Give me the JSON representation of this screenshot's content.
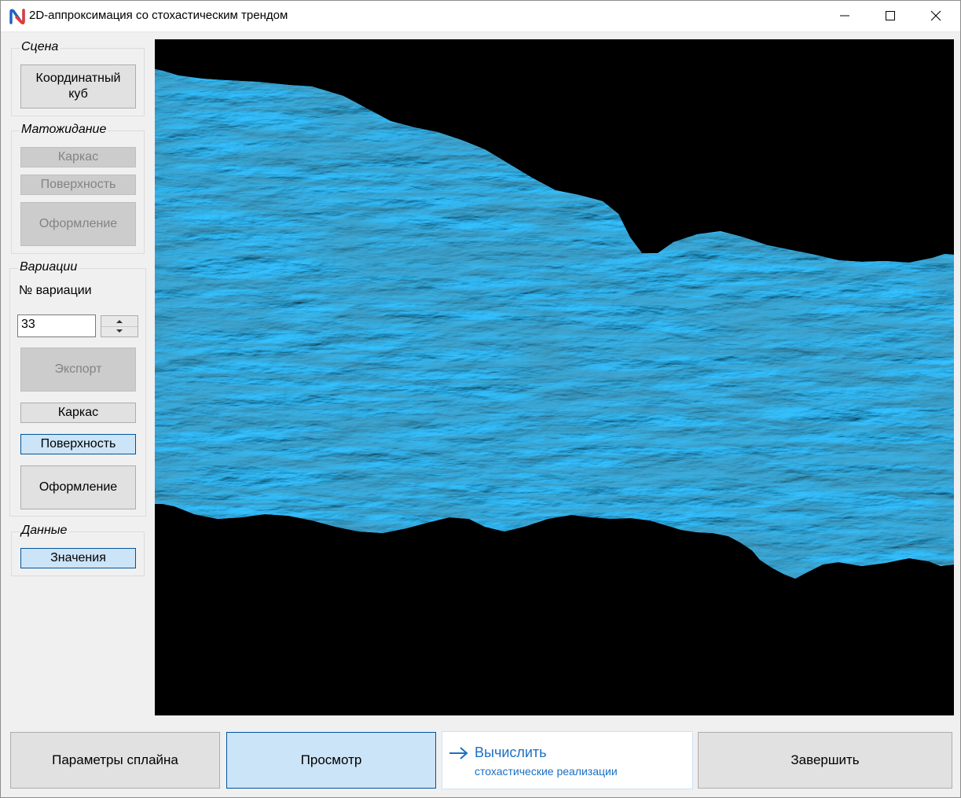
{
  "window": {
    "title": "2D-аппроксимация со стохастическим трендом",
    "controls": [
      "minimize-icon",
      "maximize-icon",
      "close-icon"
    ]
  },
  "scene": {
    "group_label": "Сцена",
    "coordinate_cube_label": "Координатный куб"
  },
  "expectation": {
    "group_label": "Матожидание",
    "wireframe_label": "Каркас",
    "surface_label": "Поверхность",
    "styling_label": "Оформление",
    "enabled": false
  },
  "variations": {
    "group_label": "Вариации",
    "number_label": "№ вариации",
    "number_value": "33",
    "export_label": "Экспорт",
    "wireframe_label": "Каркас",
    "surface_label": "Поверхность",
    "styling_label": "Оформление",
    "selected": "Поверхность"
  },
  "data": {
    "group_label": "Данные",
    "values_label": "Значения"
  },
  "viewport": {
    "background": "#000000",
    "surface_color": "#29aee8",
    "content": "3d-surface"
  },
  "bottom": {
    "spline_params_label": "Параметры сплайна",
    "preview_label": "Просмотр",
    "compute_label": "Вычислить",
    "compute_sub": "стохастические реализации",
    "finish_label": "Завершить",
    "active": "Просмотр"
  },
  "colors": {
    "accent": "#1a6fc4",
    "selected_bg": "#cce4f7",
    "selected_border": "#005499"
  }
}
